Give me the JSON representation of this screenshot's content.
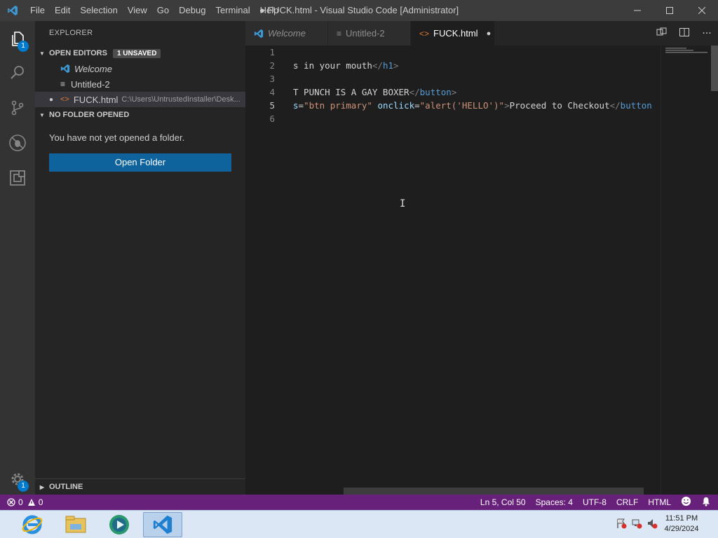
{
  "window": {
    "title": "● FUCK.html - Visual Studio Code [Administrator]",
    "menu": [
      "File",
      "Edit",
      "Selection",
      "View",
      "Go",
      "Debug",
      "Terminal",
      "Help"
    ]
  },
  "activity": {
    "explorer_badge": "1",
    "settings_badge": "1"
  },
  "sidebar": {
    "title": "EXPLORER",
    "open_editors": {
      "header": "OPEN EDITORS",
      "badge": "1 UNSAVED",
      "items": [
        {
          "label": "Welcome"
        },
        {
          "label": "Untitled-2"
        },
        {
          "label": "FUCK.html",
          "path": "C:\\Users\\UntrustedInstaller\\Desk..."
        }
      ]
    },
    "no_folder": {
      "header": "NO FOLDER OPENED",
      "message": "You have not yet opened a folder.",
      "button": "Open Folder"
    },
    "outline": "OUTLINE"
  },
  "tabs": [
    {
      "label": "Welcome"
    },
    {
      "label": "Untitled-2"
    },
    {
      "label": "FUCK.html",
      "dirty": "●"
    }
  ],
  "editor": {
    "line_numbers": [
      "1",
      "2",
      "3",
      "4",
      "5",
      "6"
    ],
    "lines": {
      "l2_text": "s in your mouth",
      "l2_close": "</",
      "l2_tag": "h1",
      "l2_end": ">",
      "l4_text": "T PUNCH IS A GAY BOXER",
      "l4_close": "</",
      "l4_tag": "button",
      "l4_end": ">",
      "l5_attr1": "s",
      "l5_eq1": "=",
      "l5_val1": "\"btn primary\"",
      "l5_attr2": "onclick",
      "l5_eq2": "=",
      "l5_val2": "\"alert('HELLO')\"",
      "l5_gt": ">",
      "l5_text": "Proceed to Checkout",
      "l5_close": "</",
      "l5_tag": "button"
    }
  },
  "status": {
    "errors": "0",
    "warnings": "0",
    "position": "Ln 5, Col 50",
    "spaces": "Spaces: 4",
    "encoding": "UTF-8",
    "eol": "CRLF",
    "language": "HTML"
  },
  "taskbar": {
    "time": "11:51 PM",
    "date": "4/29/2024"
  }
}
